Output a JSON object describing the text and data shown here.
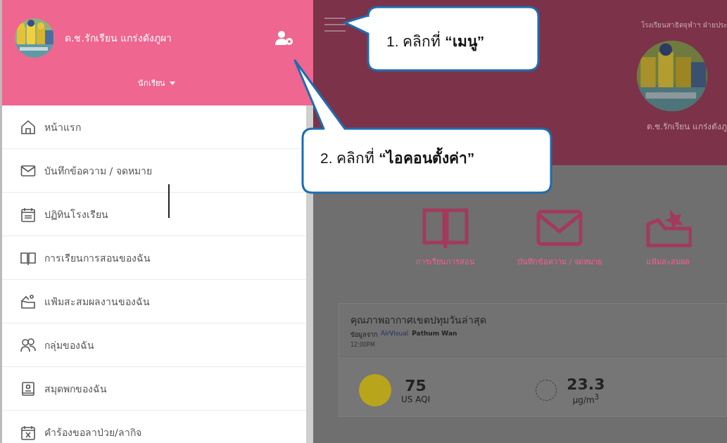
{
  "sidebar": {
    "user_name": "ด.ช.รักเรียน แกร่งดังภูผา",
    "role": "นักเรียน",
    "items": [
      {
        "label": "หน้าแรก"
      },
      {
        "label": "บันทึกข้อความ / จดหมาย"
      },
      {
        "label": "ปฏิทินโรงเรียน"
      },
      {
        "label": "การเรียนการสอนของฉัน"
      },
      {
        "label": "แฟ้มสะสมผลงานของฉัน"
      },
      {
        "label": "กลุ่มของฉัน"
      },
      {
        "label": "สมุดพกของฉัน"
      },
      {
        "label": "คำร้องขอลาป่วย/ลากิจ"
      }
    ]
  },
  "main": {
    "school": "โรงเรียนสาธิตจุฬาฯ ฝ่ายประ",
    "user_name": "ด.ช.รักเรียน แกร่งดังภู",
    "tiles": [
      {
        "label": "การเรียนการสอน"
      },
      {
        "label": "บันทึกข้อความ / จดหมาย"
      },
      {
        "label": "แฟ้มสะสมผล"
      }
    ],
    "air": {
      "title": "คุณภาพอากาศเขตปทุมวันล่าสุด",
      "source_prefix": "ข้อมูลจาก",
      "source_link": "AirVisual",
      "place": "Pathum Wan",
      "time": "12:00PM",
      "aqi_value": "75",
      "aqi_unit": "US AQI",
      "pm_value": "23.3",
      "pm_unit": "μg/m$^{3}$"
    }
  },
  "callouts": [
    "1. คลิกที่ **“เมนู”**",
    "2. คลิกที่ **“ไอคอนตั้งค่า”**"
  ]
}
